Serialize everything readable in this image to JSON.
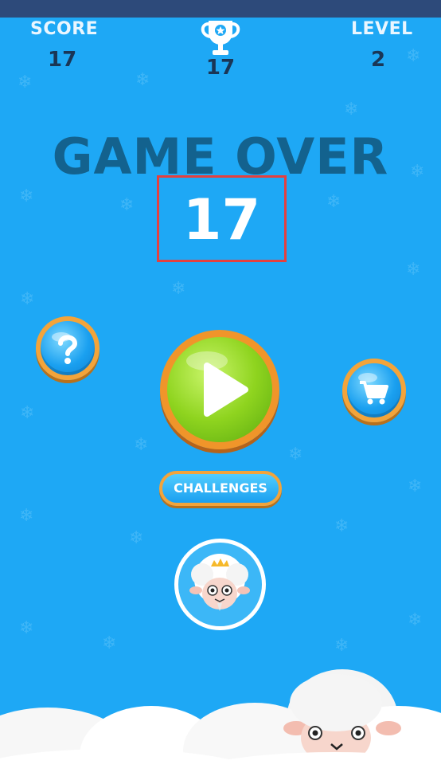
{
  "hud": {
    "score_label": "SCORE",
    "score_value": "17",
    "best_value": "17",
    "level_label": "LEVEL",
    "level_value": "2"
  },
  "game_over": {
    "title": "GAME OVER",
    "final_score": "17"
  },
  "buttons": {
    "help_icon": "question-icon",
    "play_icon": "play-icon",
    "cart_icon": "cart-icon",
    "challenges_label": "CHALLENGES"
  },
  "colors": {
    "background": "#1ea8f5",
    "title": "#13628e",
    "button_border": "#f3a43a",
    "play_green": "#8fd41f",
    "highlight_box": "#e4403f"
  }
}
